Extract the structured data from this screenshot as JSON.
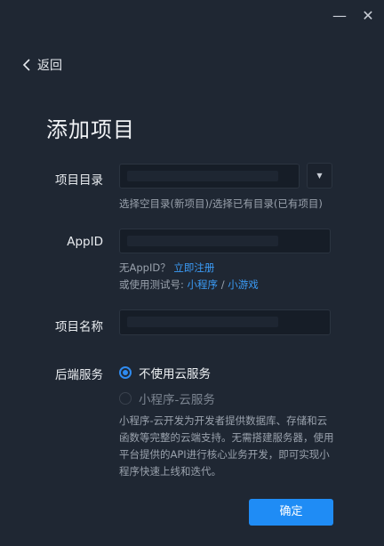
{
  "window": {
    "minimize_symbol": "—",
    "close_symbol": "✕"
  },
  "nav": {
    "back_label": "返回"
  },
  "page": {
    "title": "添加项目"
  },
  "form": {
    "directory": {
      "label": "项目目录",
      "value": "",
      "dropdown_symbol": "▼",
      "hint": "选择空目录(新项目)/选择已有目录(已有项目)"
    },
    "appid": {
      "label": "AppID",
      "value": "",
      "no_appid_text": "无AppID？",
      "register_link": "立即注册",
      "test_prefix": "或使用测试号:",
      "mini_program_link": "小程序",
      "separator": "/",
      "mini_game_link": "小游戏"
    },
    "project_name": {
      "label": "项目名称",
      "value": ""
    },
    "backend": {
      "label": "后端服务",
      "options": [
        {
          "label": "不使用云服务",
          "selected": true
        },
        {
          "label": "小程序-云服务",
          "selected": false
        }
      ],
      "description": "小程序-云开发为开发者提供数据库、存储和云函数等完整的云端支持。无需搭建服务器，使用平台提供的API进行核心业务开发，即可实现小程序快速上线和迭代。"
    }
  },
  "actions": {
    "confirm_label": "确定"
  },
  "colors": {
    "background": "#1f2733",
    "field_bg": "#161d27",
    "accent": "#1f8cf5",
    "link": "#3b9cf7"
  }
}
